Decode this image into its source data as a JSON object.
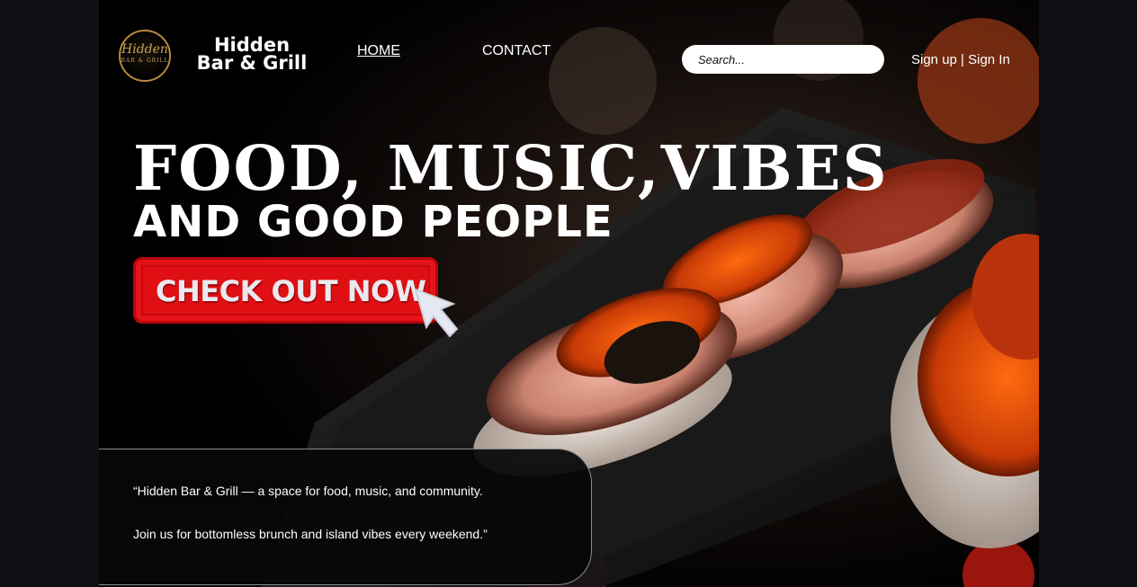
{
  "brand": {
    "logo_script": "Hidden",
    "logo_sub": "BAR & GRILL",
    "name_line1": "Hidden",
    "name_line2": "Bar & Grill"
  },
  "nav": {
    "home": "HOME",
    "contact": "CONTACT"
  },
  "search": {
    "placeholder": "Search..."
  },
  "auth": {
    "sign_up": "Sign up",
    "separator": " | ",
    "sign_in": "Sign In"
  },
  "hero": {
    "headline_1": "FOOD, MUSIC,VIBES",
    "headline_2": "AND GOOD PEOPLE",
    "cta_label": "CHECK OUT NOW"
  },
  "quote": {
    "line_1": "“Hidden Bar & Grill  — a space for food, music, and community.",
    "line_2": "Join us for bottomless brunch and island vibes every weekend.”"
  },
  "colors": {
    "accent_red": "#e00f13",
    "logo_gold": "#b8893f",
    "page_bg": "#000000"
  },
  "icons": {
    "cta_pointer": "cursor-pointer-icon"
  }
}
